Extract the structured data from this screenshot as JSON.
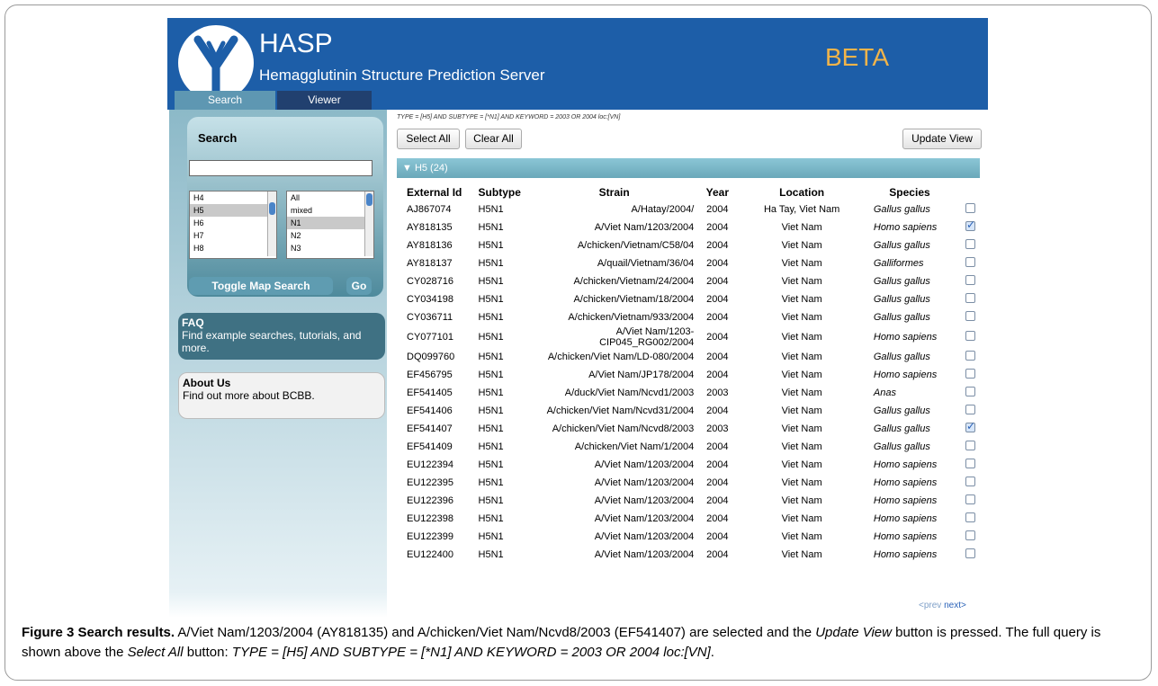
{
  "header": {
    "title": "HASP",
    "subtitle": "Hemagglutinin Structure Prediction Server",
    "badge": "BETA"
  },
  "tabs": [
    "Search",
    "Viewer"
  ],
  "sidebar": {
    "search_title": "Search",
    "search_value": "",
    "subtype_h_list": [
      "H4",
      "H5",
      "H6",
      "H7",
      "H8"
    ],
    "subtype_n_list": [
      "All",
      "mixed",
      "N1",
      "N2",
      "N3"
    ],
    "toggle_label": "Toggle Map Search",
    "go_label": "Go",
    "faq_title": "FAQ",
    "faq_text": "Find example searches, tutorials, and more.",
    "about_title": "About Us",
    "about_text": "Find out more about BCBB."
  },
  "query_text": "TYPE = [H5] AND SUBTYPE = [*N1] AND KEYWORD = 2003 OR 2004 loc:[VN]",
  "toolbar": {
    "select_all": "Select All",
    "clear_all": "Clear All",
    "update_view": "Update View"
  },
  "group_label": "▼ H5 (24)",
  "table": {
    "headers": [
      "External Id",
      "Subtype",
      "Strain",
      "Year",
      "Location",
      "Species"
    ],
    "rows": [
      {
        "id": "AJ867074",
        "subtype": "H5N1",
        "strain": "A/Hatay/2004/",
        "year": "2004",
        "location": "Ha Tay, Viet Nam",
        "species": "Gallus gallus",
        "checked": false
      },
      {
        "id": "AY818135",
        "subtype": "H5N1",
        "strain": "A/Viet Nam/1203/2004",
        "year": "2004",
        "location": "Viet Nam",
        "species": "Homo sapiens",
        "checked": true
      },
      {
        "id": "AY818136",
        "subtype": "H5N1",
        "strain": "A/chicken/Vietnam/C58/04",
        "year": "2004",
        "location": "Viet Nam",
        "species": "Gallus gallus",
        "checked": false
      },
      {
        "id": "AY818137",
        "subtype": "H5N1",
        "strain": "A/quail/Vietnam/36/04",
        "year": "2004",
        "location": "Viet Nam",
        "species": "Galliformes",
        "checked": false
      },
      {
        "id": "CY028716",
        "subtype": "H5N1",
        "strain": "A/chicken/Vietnam/24/2004",
        "year": "2004",
        "location": "Viet Nam",
        "species": "Gallus gallus",
        "checked": false
      },
      {
        "id": "CY034198",
        "subtype": "H5N1",
        "strain": "A/chicken/Vietnam/18/2004",
        "year": "2004",
        "location": "Viet Nam",
        "species": "Gallus gallus",
        "checked": false
      },
      {
        "id": "CY036711",
        "subtype": "H5N1",
        "strain": "A/chicken/Vietnam/933/2004",
        "year": "2004",
        "location": "Viet Nam",
        "species": "Gallus gallus",
        "checked": false
      },
      {
        "id": "CY077101",
        "subtype": "H5N1",
        "strain": "A/Viet Nam/1203-CIP045_RG002/2004",
        "year": "2004",
        "location": "Viet Nam",
        "species": "Homo sapiens",
        "checked": false
      },
      {
        "id": "DQ099760",
        "subtype": "H5N1",
        "strain": "A/chicken/Viet Nam/LD-080/2004",
        "year": "2004",
        "location": "Viet Nam",
        "species": "Gallus gallus",
        "checked": false
      },
      {
        "id": "EF456795",
        "subtype": "H5N1",
        "strain": "A/Viet Nam/JP178/2004",
        "year": "2004",
        "location": "Viet Nam",
        "species": "Homo sapiens",
        "checked": false
      },
      {
        "id": "EF541405",
        "subtype": "H5N1",
        "strain": "A/duck/Viet Nam/Ncvd1/2003",
        "year": "2003",
        "location": "Viet Nam",
        "species": "Anas",
        "checked": false
      },
      {
        "id": "EF541406",
        "subtype": "H5N1",
        "strain": "A/chicken/Viet Nam/Ncvd31/2004",
        "year": "2004",
        "location": "Viet Nam",
        "species": "Gallus gallus",
        "checked": false
      },
      {
        "id": "EF541407",
        "subtype": "H5N1",
        "strain": "A/chicken/Viet Nam/Ncvd8/2003",
        "year": "2003",
        "location": "Viet Nam",
        "species": "Gallus gallus",
        "checked": true
      },
      {
        "id": "EF541409",
        "subtype": "H5N1",
        "strain": "A/chicken/Viet Nam/1/2004",
        "year": "2004",
        "location": "Viet Nam",
        "species": "Gallus gallus",
        "checked": false
      },
      {
        "id": "EU122394",
        "subtype": "H5N1",
        "strain": "A/Viet Nam/1203/2004",
        "year": "2004",
        "location": "Viet Nam",
        "species": "Homo sapiens",
        "checked": false
      },
      {
        "id": "EU122395",
        "subtype": "H5N1",
        "strain": "A/Viet Nam/1203/2004",
        "year": "2004",
        "location": "Viet Nam",
        "species": "Homo sapiens",
        "checked": false
      },
      {
        "id": "EU122396",
        "subtype": "H5N1",
        "strain": "A/Viet Nam/1203/2004",
        "year": "2004",
        "location": "Viet Nam",
        "species": "Homo sapiens",
        "checked": false
      },
      {
        "id": "EU122398",
        "subtype": "H5N1",
        "strain": "A/Viet Nam/1203/2004",
        "year": "2004",
        "location": "Viet Nam",
        "species": "Homo sapiens",
        "checked": false
      },
      {
        "id": "EU122399",
        "subtype": "H5N1",
        "strain": "A/Viet Nam/1203/2004",
        "year": "2004",
        "location": "Viet Nam",
        "species": "Homo sapiens",
        "checked": false
      },
      {
        "id": "EU122400",
        "subtype": "H5N1",
        "strain": "A/Viet Nam/1203/2004",
        "year": "2004",
        "location": "Viet Nam",
        "species": "Homo sapiens",
        "checked": false
      }
    ]
  },
  "pager": {
    "prev": "<prev",
    "next": "next>"
  },
  "caption": {
    "label": "Figure 3 Search results.",
    "text1": " A/Viet Nam/1203/2004 (AY818135) and A/chicken/Viet Nam/Ncvd8/2003 (EF541407) are selected and the ",
    "italic1": "Update View",
    "text2": " button is pressed. The full query is shown above the ",
    "italic2": "Select All",
    "text3": " button: ",
    "italic3": "TYPE = [H5] AND SUBTYPE = [*N1] AND KEYWORD = 2003 OR 2004 loc:[VN]",
    "text4": "."
  }
}
